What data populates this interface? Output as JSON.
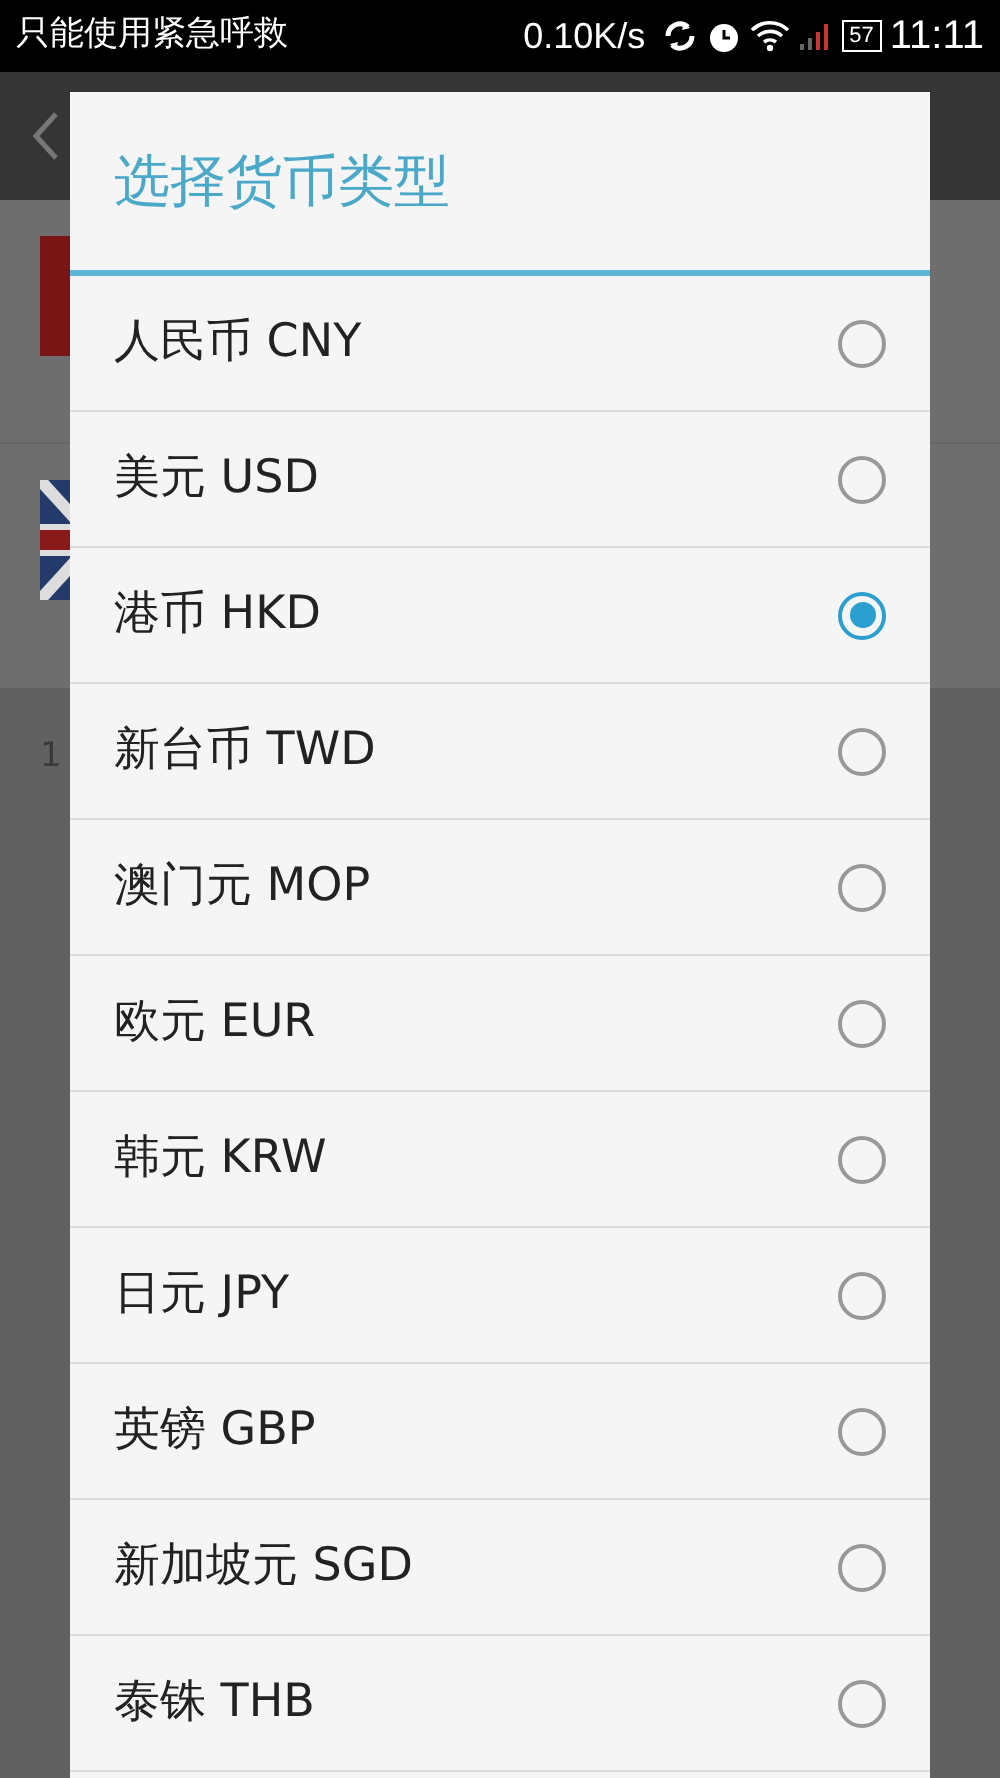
{
  "status_bar": {
    "carrier": "只能使用紧急呼救",
    "speed": "0.10K/s",
    "battery": "57",
    "time": "11:11"
  },
  "background": {
    "row_text": "1"
  },
  "dialog": {
    "title": "选择货币类型",
    "options": [
      {
        "label": "人民币 CNY",
        "selected": false
      },
      {
        "label": "美元 USD",
        "selected": false
      },
      {
        "label": "港币 HKD",
        "selected": true
      },
      {
        "label": "新台币 TWD",
        "selected": false
      },
      {
        "label": "澳门元 MOP",
        "selected": false
      },
      {
        "label": "欧元 EUR",
        "selected": false
      },
      {
        "label": "韩元 KRW",
        "selected": false
      },
      {
        "label": "日元 JPY",
        "selected": false
      },
      {
        "label": "英镑 GBP",
        "selected": false
      },
      {
        "label": "新加坡元 SGD",
        "selected": false
      },
      {
        "label": "泰铢 THB",
        "selected": false
      }
    ]
  }
}
